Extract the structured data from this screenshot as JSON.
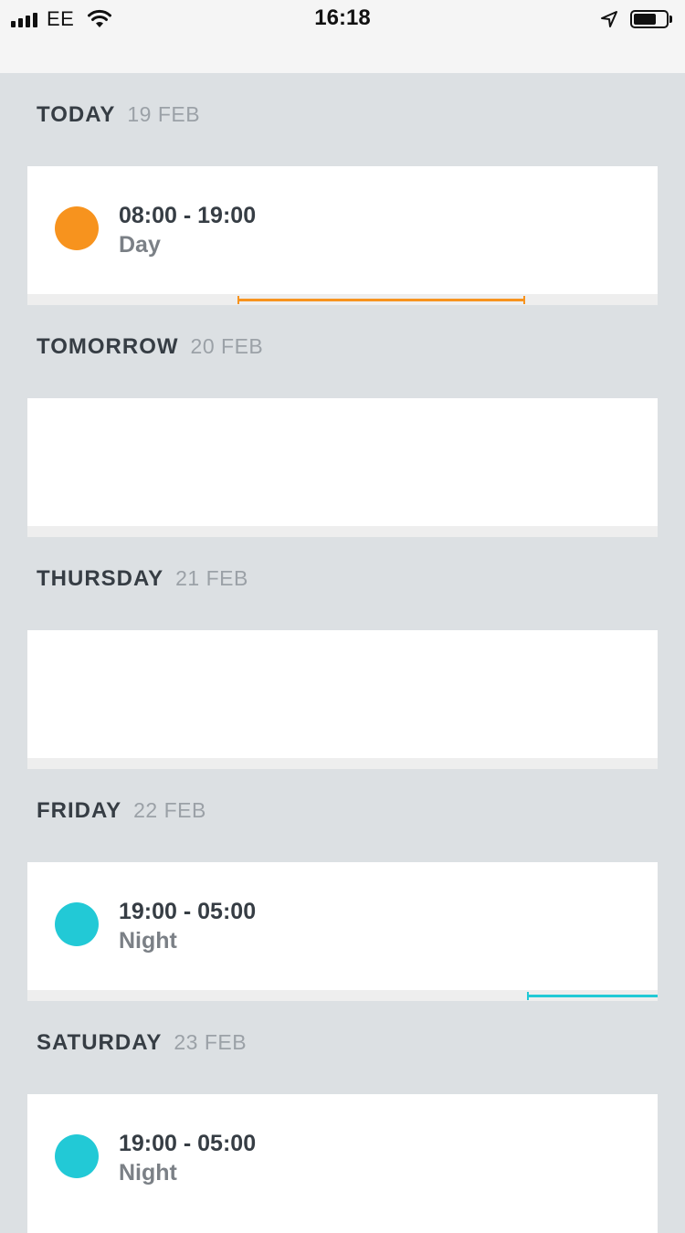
{
  "status_bar": {
    "carrier": "EE",
    "time": "16:18",
    "battery_level": 0.72
  },
  "colors": {
    "day_shift": "#f7931e",
    "night_shift": "#22c9d6"
  },
  "days": [
    {
      "name": "TODAY",
      "date": "19 FEB",
      "shift": {
        "time": "08:00 - 19:00",
        "label": "Day",
        "type": "day"
      }
    },
    {
      "name": "TOMORROW",
      "date": "20 FEB",
      "shift": null
    },
    {
      "name": "THURSDAY",
      "date": "21 FEB",
      "shift": null
    },
    {
      "name": "FRIDAY",
      "date": "22 FEB",
      "shift": {
        "time": "19:00 - 05:00",
        "label": "Night",
        "type": "night"
      }
    },
    {
      "name": "SATURDAY",
      "date": "23 FEB",
      "shift": {
        "time": "19:00 - 05:00",
        "label": "Night",
        "type": "night"
      }
    }
  ]
}
